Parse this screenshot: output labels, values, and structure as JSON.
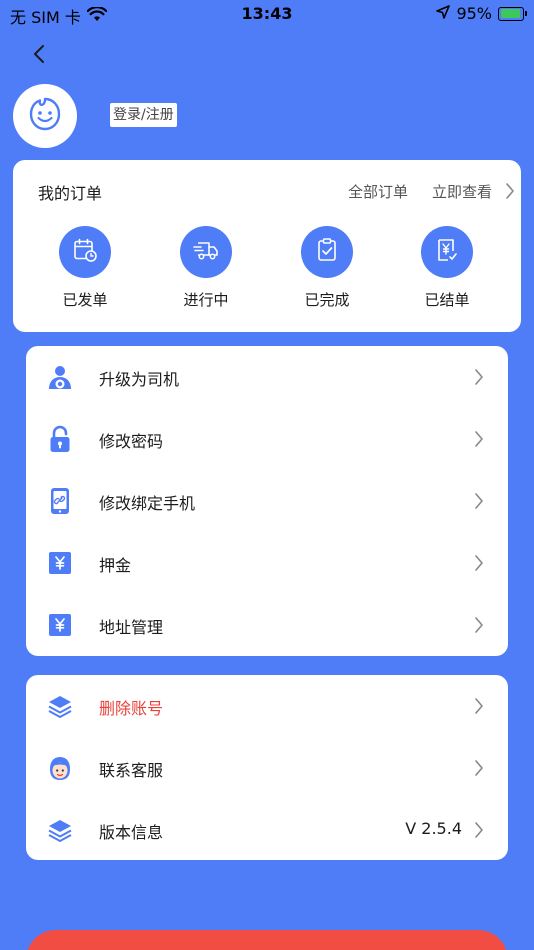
{
  "status_bar": {
    "carrier": "无 SIM 卡",
    "time": "13:43",
    "battery_percent": "95%",
    "battery_level": 0.95
  },
  "header": {
    "login_label": "登录/注册"
  },
  "orders": {
    "title": "我的订单",
    "all_label": "全部订单",
    "view_label": "立即查看",
    "items": [
      {
        "label": "已发单",
        "icon": "calendar-clock-icon"
      },
      {
        "label": "进行中",
        "icon": "truck-icon"
      },
      {
        "label": "已完成",
        "icon": "clipboard-check-icon"
      },
      {
        "label": "已结单",
        "icon": "yuan-receipt-icon"
      }
    ]
  },
  "menu_main": [
    {
      "label": "升级为司机",
      "icon": "driver-icon"
    },
    {
      "label": "修改密码",
      "icon": "lock-icon"
    },
    {
      "label": "修改绑定手机",
      "icon": "phone-link-icon"
    },
    {
      "label": "押金",
      "icon": "yuan-icon"
    },
    {
      "label": "地址管理",
      "icon": "yuan-icon"
    }
  ],
  "menu_secondary": [
    {
      "label": "删除账号",
      "icon": "layers-icon"
    },
    {
      "label": "联系客服",
      "icon": "customer-service-icon"
    },
    {
      "label": "版本信息",
      "icon": "layers-icon",
      "value": "V 2.5.4"
    }
  ],
  "colors": {
    "background": "#4f7cf7",
    "accent": "#4f7cf7",
    "danger": "#e8413a",
    "logout": "#f24d43"
  }
}
